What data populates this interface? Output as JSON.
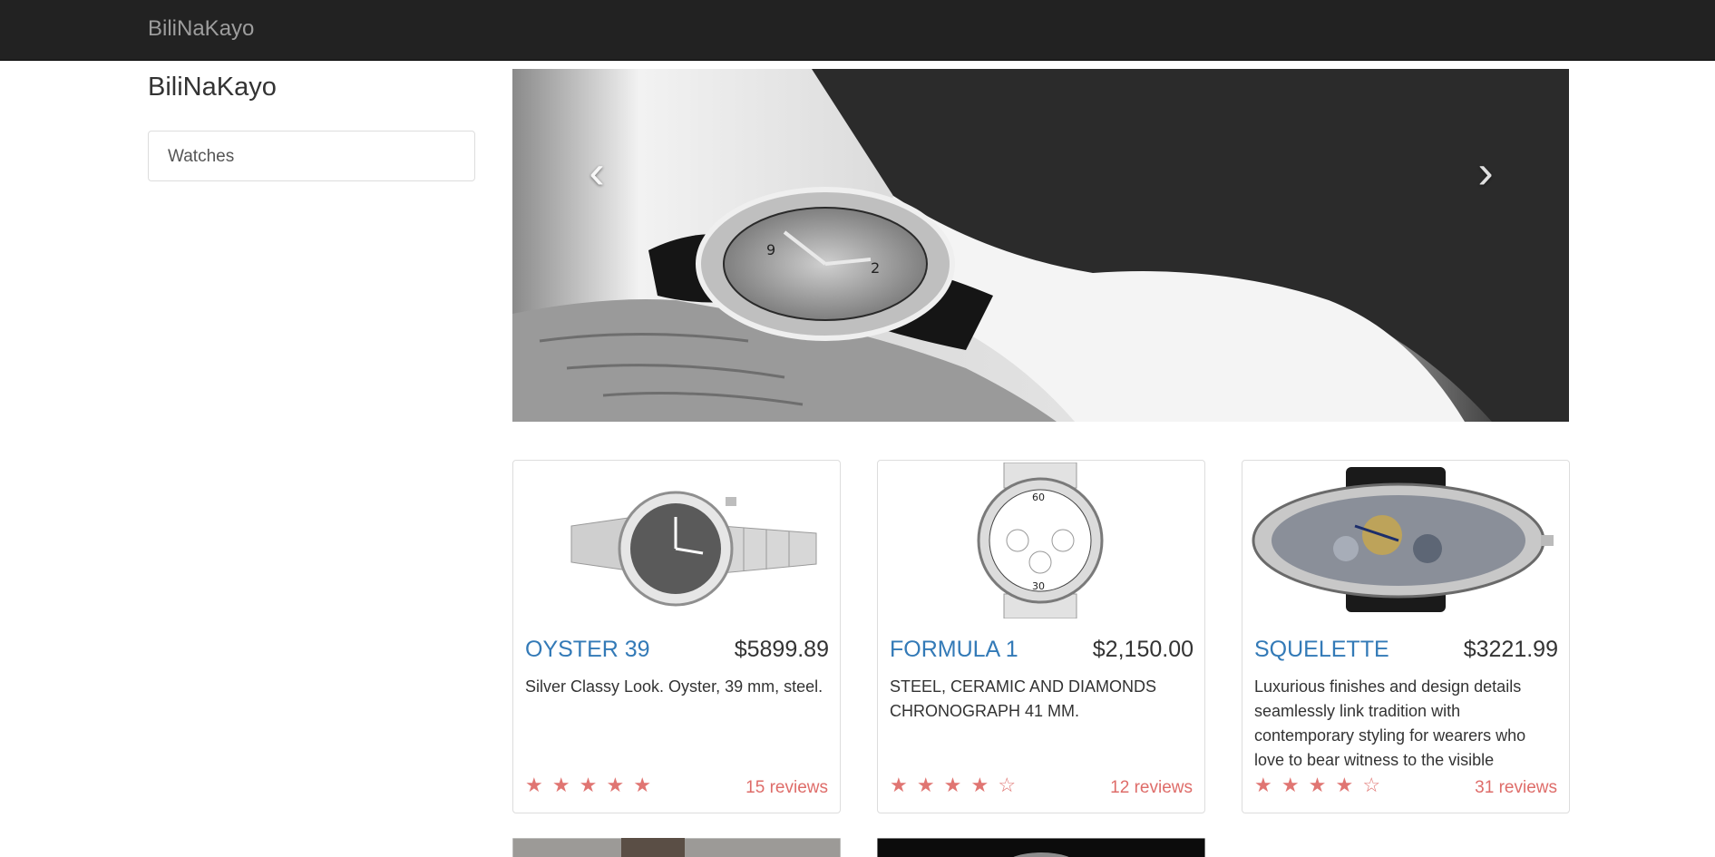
{
  "navbar": {
    "brand": "BiliNaKayo"
  },
  "sidebar": {
    "title": "BiliNaKayo",
    "items": [
      {
        "label": "Watches"
      }
    ]
  },
  "carousel": {
    "prev_icon": "chevron-left-icon",
    "next_icon": "chevron-right-icon",
    "slide_count": 3,
    "active_slide": 2
  },
  "products": [
    {
      "name": "OYSTER 39",
      "price": "$5899.89",
      "description": "Silver Classy Look. Oyster, 39 mm, steel.",
      "rating": 5,
      "stars": "★ ★ ★ ★ ★",
      "reviews": "15 reviews"
    },
    {
      "name": "FORMULA 1",
      "price": "$2,150.00",
      "description": "STEEL, CERAMIC AND DIAMONDS CHRONOGRAPH 41 MM.",
      "rating": 4,
      "stars": "★ ★ ★ ★ ☆",
      "reviews": "12 reviews"
    },
    {
      "name": "SQUELETTE",
      "price": "$3221.99",
      "description": "Luxurious finishes and design details seamlessly link tradition with contemporary styling for wearers who love to bear witness to the visible",
      "rating": 4,
      "stars": "★ ★ ★ ★ ☆",
      "reviews": "31 reviews"
    }
  ],
  "colors": {
    "navbar": "#222222",
    "link": "#337ab7",
    "star": "#d9534f"
  }
}
